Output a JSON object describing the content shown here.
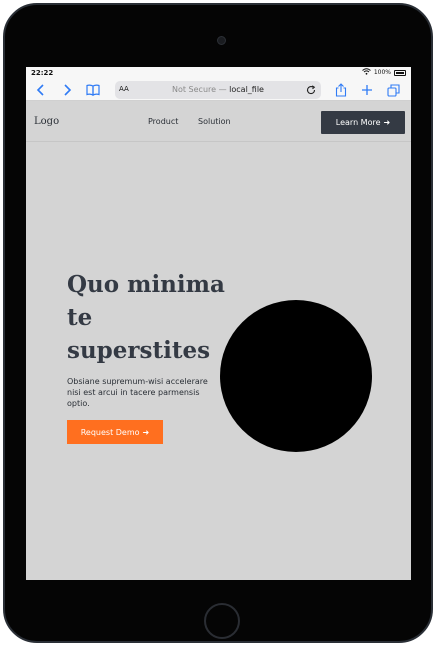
{
  "status_bar": {
    "time": "22:22",
    "battery": "100%"
  },
  "browser": {
    "aa_label": "AA",
    "url_prefix": "Not Secure —",
    "url_host": "local_file"
  },
  "site": {
    "logo": "Logo",
    "nav_links": [
      "Product",
      "Solution"
    ],
    "cta_label": "Learn More",
    "cta_arrow": "➜"
  },
  "hero": {
    "title": "Quo minima te superstites",
    "description": "Obsiane supremum-wisi accelerare nisi est arcui in tacere parmensis optio.",
    "button_label": "Request Demo",
    "button_arrow": "➜"
  },
  "colors": {
    "page_bg": "#d4d4d4",
    "dark": "#343a44",
    "accent": "#ff6f1f",
    "link_blue": "#2f7bf5"
  },
  "icons": [
    "back-chevron-icon",
    "forward-chevron-icon",
    "bookmarks-icon",
    "reload-icon",
    "share-icon",
    "new-tab-plus-icon",
    "tabs-icon",
    "wifi-icon",
    "battery-icon",
    "arrow-right-icon"
  ]
}
